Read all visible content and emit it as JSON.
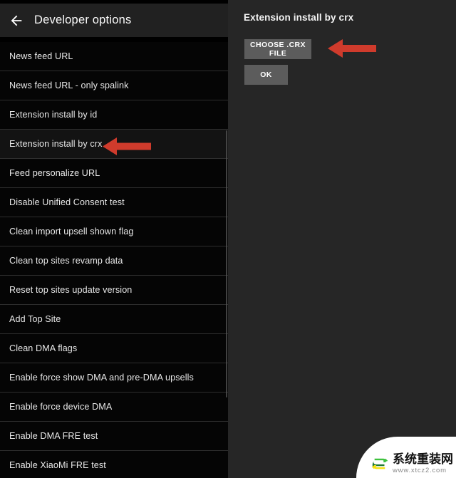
{
  "app": {
    "header": {
      "title": "Developer options",
      "back_icon": "back-arrow-icon"
    }
  },
  "left_panel": {
    "rows": [
      {
        "label": "News feed URL",
        "selected": false
      },
      {
        "label": "News feed URL - only spalink",
        "selected": false
      },
      {
        "label": "Extension install by id",
        "selected": false
      },
      {
        "label": "Extension install by crx",
        "selected": true
      },
      {
        "label": "Feed personalize URL",
        "selected": false
      },
      {
        "label": "Disable Unified Consent test",
        "selected": false
      },
      {
        "label": "Clean import upsell shown flag",
        "selected": false
      },
      {
        "label": "Clean top sites revamp data",
        "selected": false
      },
      {
        "label": "Reset top sites update version",
        "selected": false
      },
      {
        "label": "Add Top Site",
        "selected": false
      },
      {
        "label": "Clean DMA flags",
        "selected": false
      },
      {
        "label": "Enable force show DMA and pre-DMA upsells",
        "selected": false
      },
      {
        "label": "Enable force device DMA",
        "selected": false
      },
      {
        "label": "Enable DMA FRE test",
        "selected": false
      },
      {
        "label": "Enable XiaoMi FRE test",
        "selected": false
      }
    ],
    "scrollbar": {
      "name": "vertical-scrollbar"
    },
    "annotation_arrow": {
      "name": "red-arrow-pointing-left",
      "color": "#cf3b2c"
    }
  },
  "right_panel": {
    "title": "Extension install by crx",
    "choose_button_label": "CHOOSE .CRX FILE",
    "ok_button_label": "OK",
    "annotation_arrow": {
      "name": "red-arrow-pointing-left",
      "color": "#cf3b2c"
    }
  },
  "watermark": {
    "site_name": "系统重装网",
    "url": "www.xtcz2.com",
    "logo": "recycle-arrows-logo"
  },
  "colors": {
    "appbar_bg": "#212121",
    "list_bg": "#050505",
    "row_selected_bg": "#131313",
    "divider": "#2e2e2e",
    "dialog_bg": "#262626",
    "button_bg": "#5c5c5c",
    "arrow_red": "#cf3b2c",
    "text_primary": "#e8e8e8"
  }
}
